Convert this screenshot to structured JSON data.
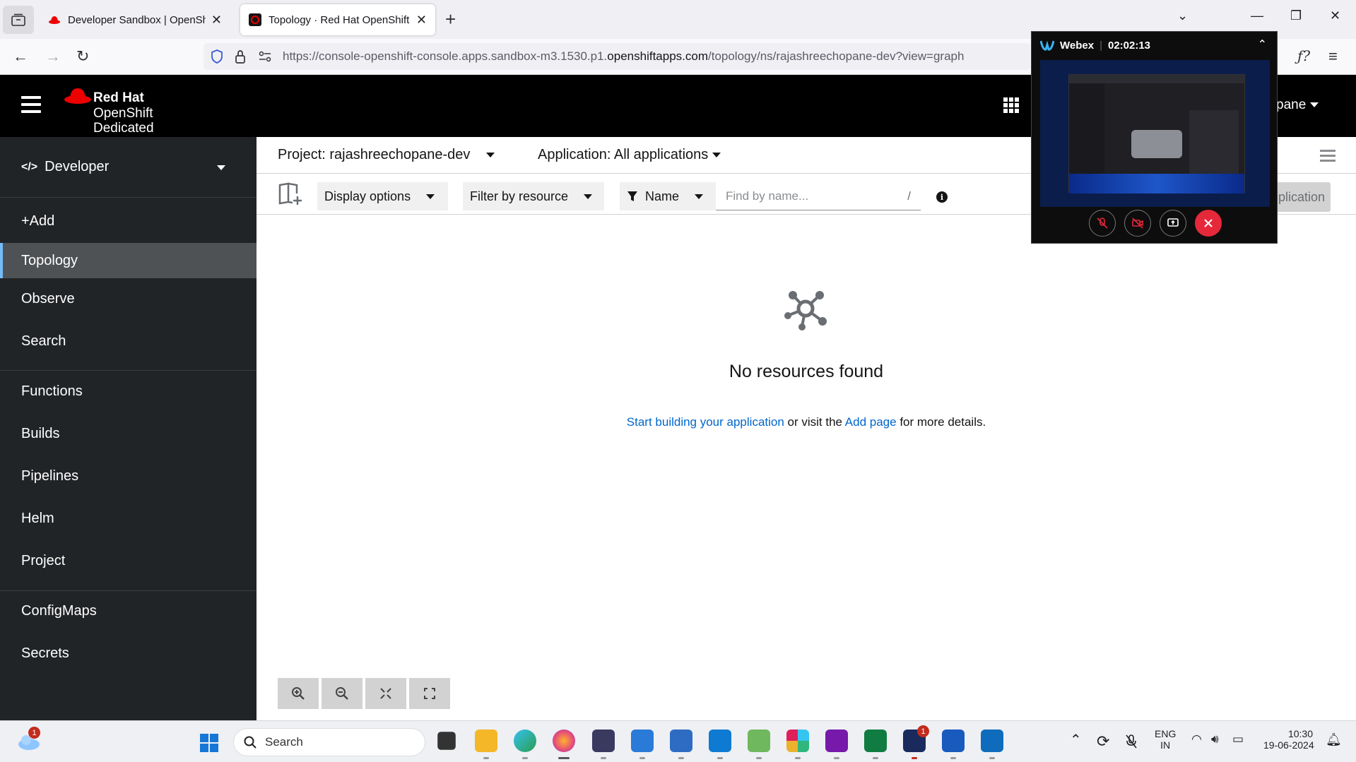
{
  "browser": {
    "tabs": [
      {
        "title": "Developer Sandbox | OpenShift",
        "active": false
      },
      {
        "title": "Topology · Red Hat OpenShift D",
        "active": true
      }
    ],
    "url_prefix": "https://console-openshift-console.apps.sandbox-m3.1530.p1.",
    "url_domain": "openshiftapps.com",
    "url_suffix": "/topology/ns/rajashreechopane-dev?view=graph"
  },
  "masthead": {
    "brand_line1": "Red Hat",
    "brand_line2": "OpenShift",
    "brand_line3": "Dedicated",
    "user_name": "pane"
  },
  "sidebar": {
    "perspective": "Developer",
    "perspective_icon": "</>",
    "items": [
      {
        "label": "+Add"
      },
      {
        "label": "Topology",
        "active": true
      },
      {
        "label": "Observe"
      },
      {
        "label": "Search"
      },
      {
        "label": "Functions"
      },
      {
        "label": "Builds"
      },
      {
        "label": "Pipelines"
      },
      {
        "label": "Helm"
      },
      {
        "label": "Project"
      },
      {
        "label": "ConfigMaps"
      },
      {
        "label": "Secrets"
      }
    ]
  },
  "main": {
    "project_label": "Project: rajashreechopane-dev",
    "application_label": "Application: All applications",
    "toolbar": {
      "display_options": "Display options",
      "filter_by_resource": "Filter by resource",
      "filter_type": "Name",
      "search_placeholder": "Find by name...",
      "search_shortcut": "/",
      "create_app_partial": "plication"
    },
    "empty_state": {
      "title": "No resources found",
      "link1": "Start building your application",
      "middle": " or visit the ",
      "link2": "Add page",
      "end": " for more details."
    }
  },
  "webex": {
    "app_name": "Webex",
    "timer": "02:02:13"
  },
  "taskbar": {
    "search_label": "Search",
    "weather_badge": "1",
    "webex_badge": "1",
    "lang1": "ENG",
    "lang2": "IN",
    "time": "10:30",
    "date": "19-06-2024"
  },
  "colors": {
    "masthead": "#000000",
    "sidebar": "#212427",
    "active_nav": "#4f5255",
    "active_border": "#73bcf7",
    "link": "#0066cc",
    "webex_end": "#e5283a"
  }
}
